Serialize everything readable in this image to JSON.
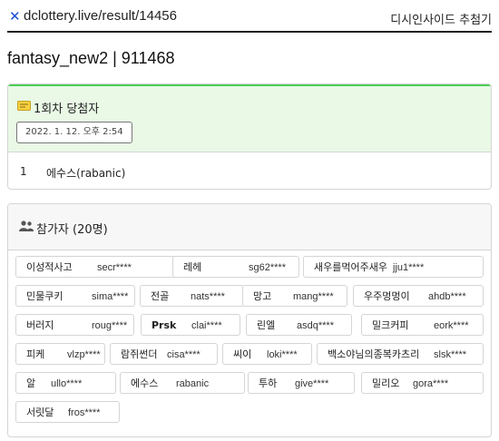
{
  "header": {
    "logo_glyph": "✕",
    "url": "dclottery.live/result/14456",
    "brand": "디시인사이드 추첨기"
  },
  "page": {
    "title": "fantasy_new2 | 911468"
  },
  "winners": {
    "title": "1회차 당첨자",
    "date": "2022. 1. 12. 오후 2:54",
    "rows": [
      {
        "num": "1",
        "name": "에수스(rabanic)"
      }
    ]
  },
  "entrants": {
    "title": "참가자 (20명)",
    "items": [
      {
        "name": "이성적사고",
        "id": "secr****"
      },
      {
        "name": "레헤",
        "id": "sg62****"
      },
      {
        "name": "새우를먹어주새우",
        "id": "jju1****"
      },
      {
        "name": "민물쿠키",
        "id": "sima****"
      },
      {
        "name": "전골",
        "id": "nats****"
      },
      {
        "name": "망고",
        "id": "mang****"
      },
      {
        "name": "우주멍멍이",
        "id": "ahdb****"
      },
      {
        "name": "버러지",
        "id": "roug****"
      },
      {
        "name": "Prsk",
        "id": "clai****"
      },
      {
        "name": "린엘",
        "id": "asdq****"
      },
      {
        "name": "밀크커피",
        "id": "eork****"
      },
      {
        "name": "피케",
        "id": "vlzp****"
      },
      {
        "name": "람쥐썬더",
        "id": "cisa****"
      },
      {
        "name": "씨이",
        "id": "loki****"
      },
      {
        "name": "백소야님의종복카츠리",
        "id": "slsk****"
      },
      {
        "name": "알",
        "id": "ullo****"
      },
      {
        "name": "에수스",
        "id": "rabanic"
      },
      {
        "name": "투하",
        "id": "give****"
      },
      {
        "name": "밀리오",
        "id": "gora****"
      },
      {
        "name": "서릿달",
        "id": "fros****"
      }
    ]
  },
  "colors": {
    "accent_green": "#4ccf58",
    "winner_bg": "#e9f9e6",
    "logo_blue": "#1a4fd6"
  }
}
